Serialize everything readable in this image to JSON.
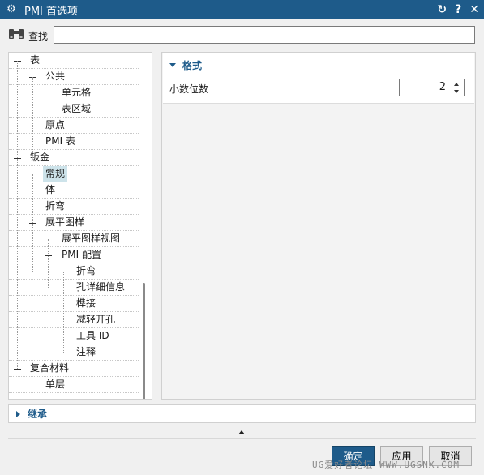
{
  "window": {
    "title": "PMI 首选项",
    "icons": {
      "app": "gear-icon",
      "reset": "reset-icon",
      "help": "help-icon",
      "close": "close-icon"
    }
  },
  "search": {
    "label": "查找",
    "value": ""
  },
  "tree": [
    {
      "label": "表",
      "expanded": true,
      "selected": false
    },
    {
      "label": "公共",
      "expanded": true,
      "selected": false
    },
    {
      "label": "单元格",
      "selected": false
    },
    {
      "label": "表区域",
      "selected": false
    },
    {
      "label": "原点",
      "selected": false
    },
    {
      "label": "PMI 表",
      "selected": false
    },
    {
      "label": "钣金",
      "expanded": true,
      "selected": false
    },
    {
      "label": "常规",
      "selected": true
    },
    {
      "label": "体",
      "selected": false
    },
    {
      "label": "折弯",
      "selected": false
    },
    {
      "label": "展平图样",
      "expanded": true,
      "selected": false
    },
    {
      "label": "展平图样视图",
      "selected": false
    },
    {
      "label": "PMI 配置",
      "expanded": true,
      "selected": false
    },
    {
      "label": "折弯",
      "selected": false
    },
    {
      "label": "孔详细信息",
      "selected": false
    },
    {
      "label": "榫接",
      "selected": false
    },
    {
      "label": "减轻开孔",
      "selected": false
    },
    {
      "label": "工具 ID",
      "selected": false
    },
    {
      "label": "注释",
      "selected": false
    },
    {
      "label": "复合材料",
      "expanded": true,
      "selected": false
    },
    {
      "label": "单层",
      "selected": false
    }
  ],
  "format_group": {
    "title": "格式",
    "decimal_places_label": "小数位数",
    "decimal_places_value": "2"
  },
  "inherit": {
    "label": "继承"
  },
  "buttons": {
    "ok": "确定",
    "apply": "应用",
    "cancel": "取消"
  },
  "watermark": "UG爱好者论坛 WWW.UGSNX.COM",
  "colors": {
    "accent": "#1e5b8a",
    "selection": "#cde3ea"
  }
}
